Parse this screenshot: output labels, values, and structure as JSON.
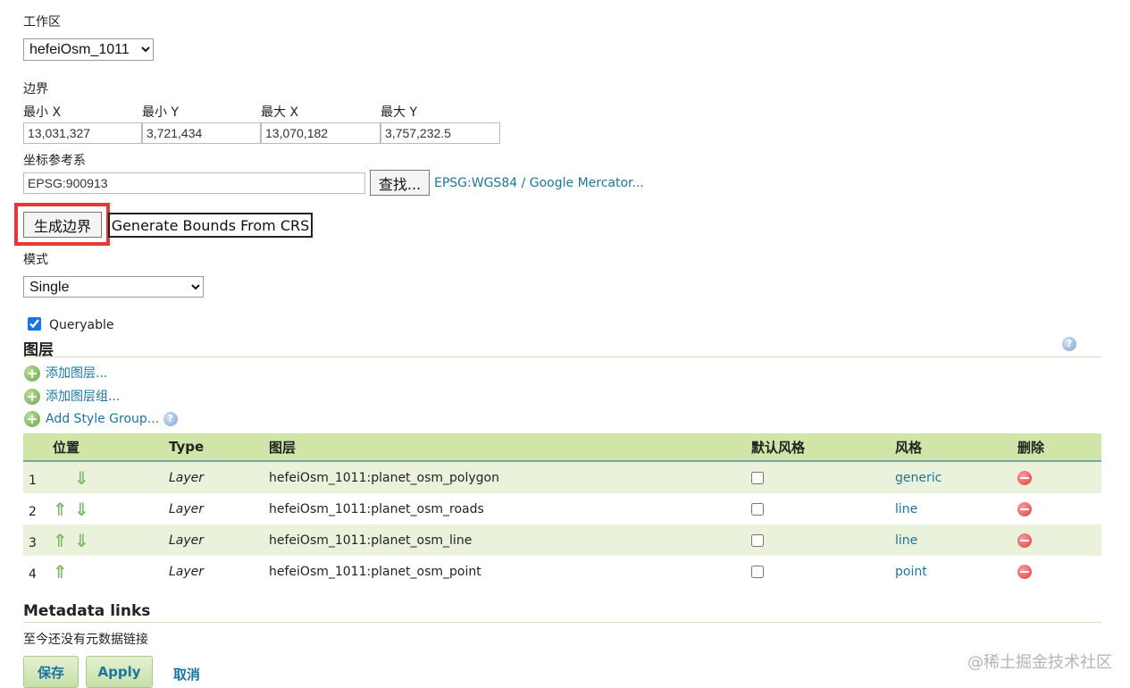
{
  "workspace": {
    "label": "工作区",
    "selected": "hefeiOsm_1011"
  },
  "bounds": {
    "label": "边界",
    "columns": [
      {
        "label": "最小 X",
        "value": "13,031,327"
      },
      {
        "label": "最小 Y",
        "value": "3,721,434"
      },
      {
        "label": "最大 X",
        "value": "13,070,182"
      },
      {
        "label": "最大 Y",
        "value": "3,757,232.5"
      }
    ]
  },
  "crs": {
    "label": "坐标参考系",
    "value": "EPSG:900913",
    "find_label": "查找...",
    "link_text": "EPSG:WGS84 / Google Mercator..."
  },
  "actions": {
    "generate_bounds": "生成边界",
    "generate_from_crs": "Generate Bounds From CRS"
  },
  "mode": {
    "label": "模式",
    "selected": "Single"
  },
  "queryable": {
    "label": "Queryable",
    "checked": true
  },
  "layers": {
    "title": "图层",
    "add_layer": "添加图层...",
    "add_layer_group": "添加图层组...",
    "add_style_group": "Add Style Group...",
    "headers": {
      "position": "位置",
      "type": "Type",
      "layer": "图层",
      "default_style": "默认风格",
      "style": "风格",
      "delete": "删除"
    },
    "rows": [
      {
        "num": "1",
        "type": "Layer",
        "name": "hefeiOsm_1011:planet_osm_polygon",
        "style": "generic"
      },
      {
        "num": "2",
        "type": "Layer",
        "name": "hefeiOsm_1011:planet_osm_roads",
        "style": "line"
      },
      {
        "num": "3",
        "type": "Layer",
        "name": "hefeiOsm_1011:planet_osm_line",
        "style": "line"
      },
      {
        "num": "4",
        "type": "Layer",
        "name": "hefeiOsm_1011:planet_osm_point",
        "style": "point"
      }
    ]
  },
  "metadata": {
    "title": "Metadata links",
    "empty_text": "至今还没有元数据链接"
  },
  "footer": {
    "save": "保存",
    "apply": "Apply",
    "cancel": "取消"
  },
  "watermark": "@稀土掘金技术社区",
  "colors": {
    "link": "#1a76a0",
    "table_header": "#cfe6a8",
    "row_alt": "#eaf2dc",
    "highlight": "#e53935"
  }
}
